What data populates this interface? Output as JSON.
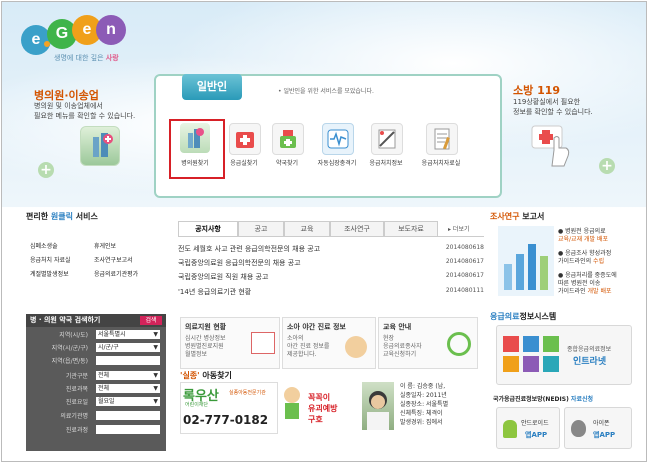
{
  "logo": {
    "letters": [
      "e",
      "G",
      "e",
      "n"
    ],
    "tagline_prefix": "생명에 대한 깊은",
    "tagline_accent": "사랑"
  },
  "left_panel": {
    "title": "병의원·이송업",
    "desc1": "병의원 및 이송업체에서",
    "desc2": "필요한 메뉴를 확인할 수 있습니다."
  },
  "center_panel": {
    "tab": "일반인",
    "desc": "• 일반인을 위한 서비스를 모았습니다.",
    "icons": [
      "병의원찾기",
      "응급실찾기",
      "약국찾기",
      "자동심장충격기",
      "응급처치정보",
      "응급처치자료실"
    ]
  },
  "right_panel": {
    "title": "소방 119",
    "desc1": "119상황실에서 필요한",
    "desc2": "정보를 확인할 수 있습니다."
  },
  "quick": {
    "title_prefix": "편리한",
    "title_accent": "원클릭",
    "title_suffix": "서비스",
    "items": [
      "심폐소생술",
      "휴게인보",
      "응급처치 자료실",
      "조사연구보고서",
      "계절별발생정보",
      "응급의료기관평가"
    ]
  },
  "news": {
    "tabs": [
      "공지사항",
      "공고",
      "교육",
      "조사연구",
      "보도자료"
    ],
    "more": "더보기",
    "rows": [
      {
        "title": "전도 세월호 사고 관련 응급의학전문의 채용 공고",
        "date": "2014080618"
      },
      {
        "title": "국립중앙의료원 응급의학전문의 채용 공고",
        "date": "2014080617"
      },
      {
        "title": "국립중앙의료원 직원 채용 공고",
        "date": "2014080617"
      },
      {
        "title": "'14년 응급의료기관 현황",
        "date": "2014080111"
      }
    ]
  },
  "search": {
    "title": "병 · 의원 약국 검색하기",
    "button": "검색",
    "fields": [
      {
        "label": "지역(시/도)",
        "value": "서울특별시"
      },
      {
        "label": "지역(시/군/구)",
        "value": "시/군/구"
      },
      {
        "label": "지역(읍/면/동)",
        "value": ""
      },
      {
        "label": "기관구분",
        "value": "전체"
      },
      {
        "label": "진료과목",
        "value": "전체"
      },
      {
        "label": "진료요일",
        "value": "월요일"
      },
      {
        "label": "의료기관명",
        "value": ""
      },
      {
        "label": "진료과정",
        "value": ""
      }
    ]
  },
  "info_boxes": [
    {
      "title": "의료지원 현황",
      "lines": [
        "심시간 병상정보",
        "병원별진료지원",
        "월별정보"
      ]
    },
    {
      "title": "소아 야간 진료 정보",
      "lines": [
        "소아의",
        "야간 진료 정보를",
        "제공합니다."
      ]
    },
    {
      "title": "교육 안내",
      "lines": [
        "현장",
        "응급의료종사자",
        "교육신청하기"
      ]
    }
  ],
  "missing": {
    "title_accent": "'실종'",
    "title_suffix": "아동찾기",
    "banner_name": "록우산",
    "banner_sub": "어린이재단",
    "banner_tag": "실종아동전문기관",
    "phone": "02-777-0182",
    "prevent1": "꼭꼭이",
    "prevent2": "유괴예방",
    "prevent3": "구호",
    "profile": [
      "이 름: 김승중 (남,",
      "실종일자: 2011년 ",
      "실종장소: 서울특별",
      "신체특징: 체격이",
      "발생경위: 집에서 "
    ]
  },
  "research": {
    "title_accent": "조사연구",
    "title_suffix": "보고서",
    "items": [
      {
        "main": "● 병원전 응급의료",
        "accent": "교육/교재 개발 배포"
      },
      {
        "main": "● 응급조사 향성과정",
        "sub": "가이드라인의",
        "accent": "수립"
      },
      {
        "main": "● 응급처리를 중증도에",
        "sub": "따른 병원전 이송",
        "sub2": "가이드라인",
        "accent": "개발 배포"
      }
    ]
  },
  "em_system": {
    "title_accent": "응급의료",
    "title_suffix": "정보시스템",
    "line1": "종합응급의료정보",
    "line2": "인트라넷"
  },
  "neds": {
    "title_prefix": "국가응급진료정보망(NEDIS)",
    "title_suffix": "자료신청"
  },
  "apps": {
    "android": "안드로이드",
    "android_sub": "앱APP",
    "iphone": "아이폰",
    "iphone_sub": "앱APP"
  }
}
